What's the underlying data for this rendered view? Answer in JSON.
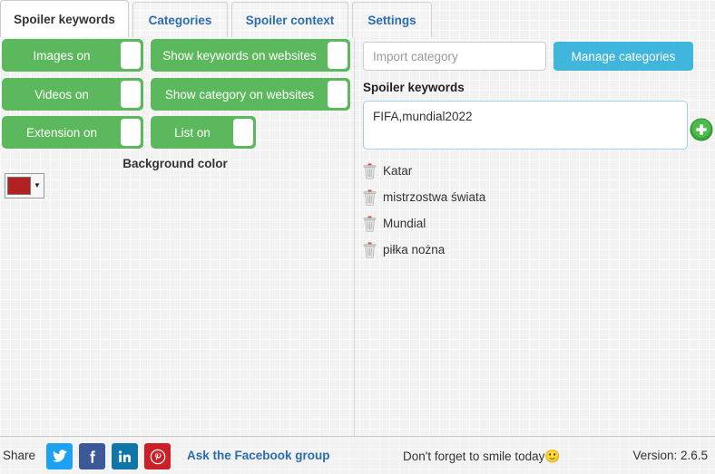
{
  "tabs": [
    {
      "label": "Spoiler keywords",
      "active": true
    },
    {
      "label": "Categories",
      "active": false
    },
    {
      "label": "Spoiler context",
      "active": false
    },
    {
      "label": "Settings",
      "active": false
    }
  ],
  "left": {
    "toggles": [
      {
        "label": "Images on",
        "state": "on"
      },
      {
        "label": "Videos on",
        "state": "on"
      },
      {
        "label": "Extension on",
        "state": "on"
      },
      {
        "label": "Show keywords on websites",
        "state": "on"
      },
      {
        "label": "Show category on websites",
        "state": "on"
      },
      {
        "label": "List on",
        "state": "on"
      }
    ],
    "background_color_label": "Background color",
    "background_color_value": "#B22222",
    "color_caret": "▼"
  },
  "right": {
    "import_placeholder": "Import category",
    "import_value": "",
    "manage_button": "Manage categories",
    "keywords_heading": "Spoiler keywords",
    "keyword_input_value": "FIFA,mundial2022",
    "add_icon": "plus-circle-icon",
    "keywords": [
      "Katar",
      "mistrzostwa świata",
      "Mundial",
      "piłka nożna"
    ]
  },
  "footer": {
    "share_label": "Share",
    "social": [
      {
        "name": "twitter",
        "glyph": "🐦"
      },
      {
        "name": "facebook",
        "glyph": "f"
      },
      {
        "name": "linkedin",
        "glyph": "in"
      },
      {
        "name": "pinterest",
        "glyph": "Ⓟ"
      }
    ],
    "facebook_group_link": "Ask the Facebook group",
    "smile_text": "Don't forget to smile today",
    "smiley": "🙂",
    "version_text": "Version: 2.6.5"
  },
  "colors": {
    "toggle_green": "#5CB85C",
    "accent_blue": "#41B6DC",
    "tab_link_blue": "#2A6CB0",
    "add_green": "#3AA63A"
  }
}
